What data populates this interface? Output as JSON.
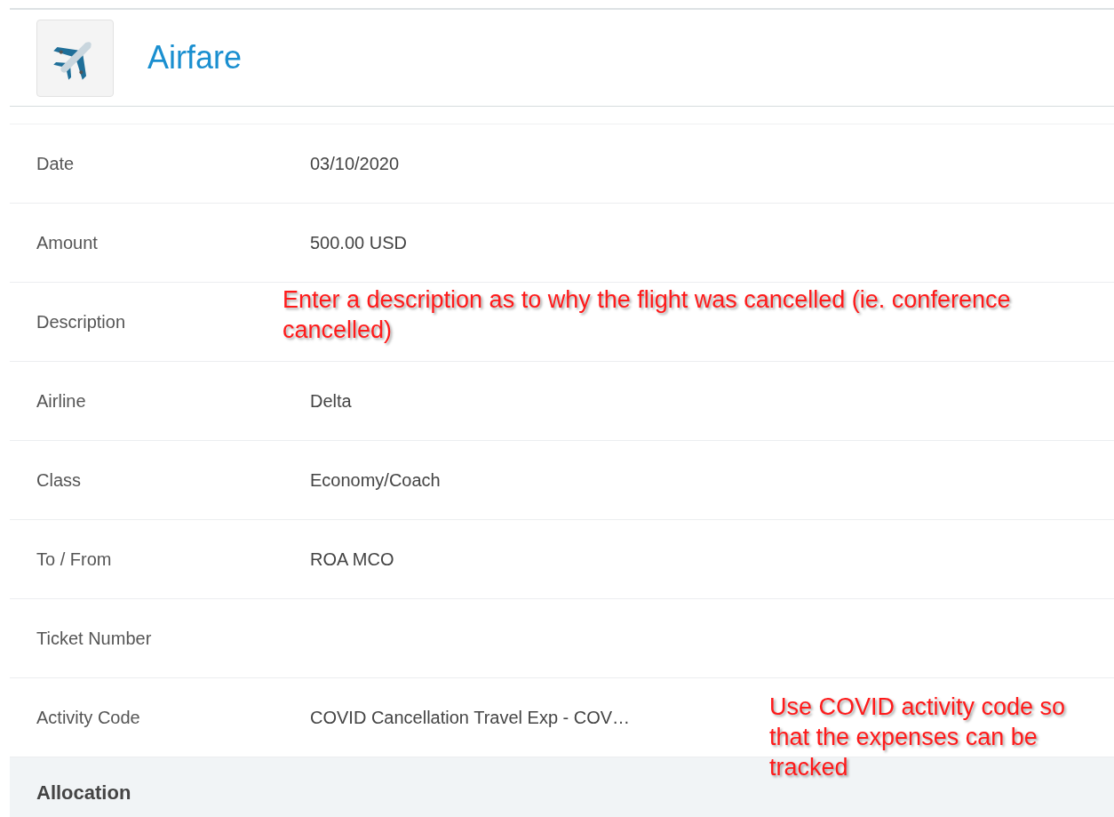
{
  "header": {
    "title": "Airfare"
  },
  "fields": [
    {
      "label": "Date",
      "value": "03/10/2020"
    },
    {
      "label": "Amount",
      "value": "500.00 USD"
    },
    {
      "label": "Description"
    },
    {
      "label": "Airline",
      "value": "Delta"
    },
    {
      "label": "Class",
      "value": "Economy/Coach"
    },
    {
      "label": "To / From",
      "value": "ROA MCO"
    },
    {
      "label": "Ticket Number"
    },
    {
      "label": "Activity Code",
      "value": "COVID Cancellation Travel Exp - COV…"
    }
  ],
  "section": {
    "title": "Allocation"
  },
  "annotations": [
    {
      "text": "Enter a description as to why the flight was cancelled (ie. conference cancelled)"
    },
    {
      "text": "Use COVID activity code so that the expenses can be tracked"
    }
  ]
}
